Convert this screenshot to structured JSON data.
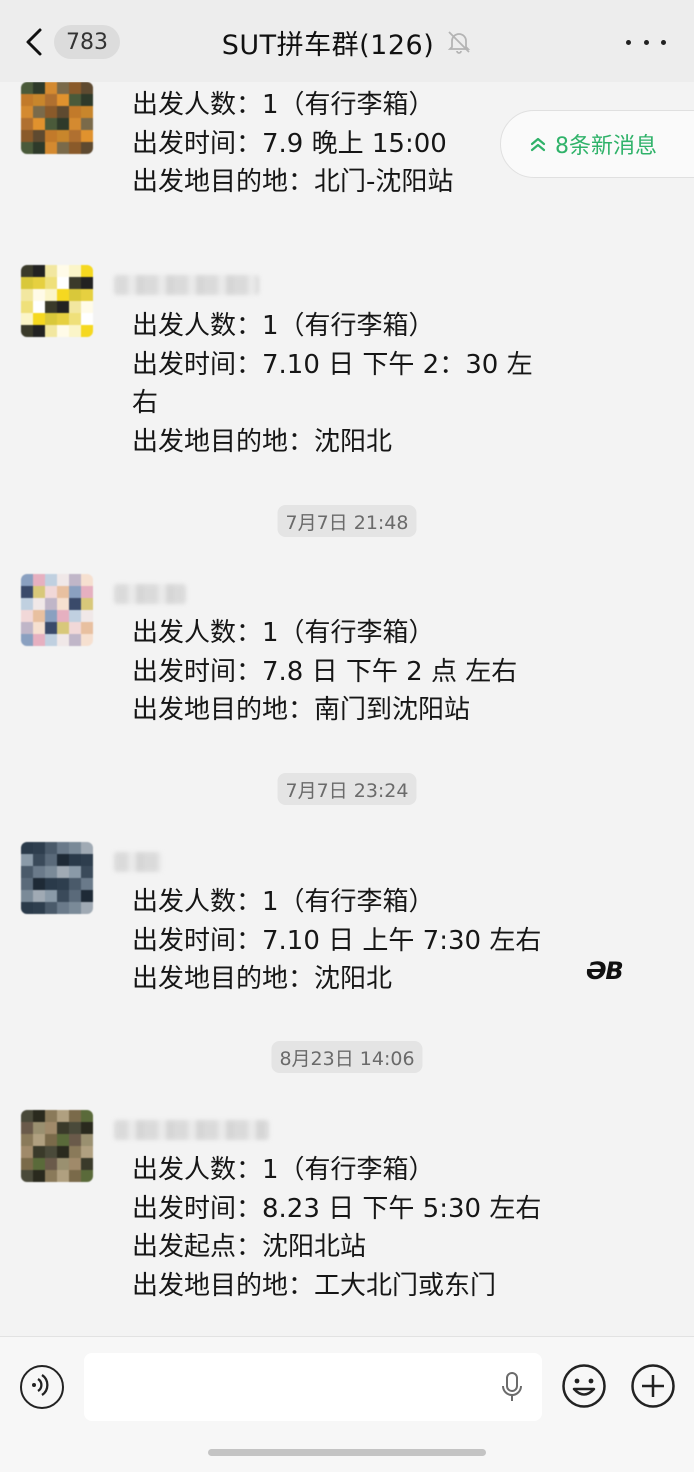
{
  "header": {
    "unread_count": "783",
    "title": "SUT拼车群(126)"
  },
  "new_messages_pill": "8条新消息",
  "timestamps": [
    "7月7日 21:48",
    "7月7日 23:24",
    "8月23日 14:06"
  ],
  "messages": [
    {
      "lines": [
        "出发人数：1（有行李箱）",
        "出发时间：7.9 晚上 15:00",
        "出发地目的地：北门-沈阳站"
      ]
    },
    {
      "lines": [
        "出发人数：1（有行李箱）",
        "出发时间：7.10 日 下午 2：30 左",
        "右",
        "出发地目的地：沈阳北"
      ]
    },
    {
      "lines": [
        "出发人数：1（有行李箱）",
        "出发时间：7.8 日 下午 2 点 左右",
        "出发地目的地：南门到沈阳站"
      ]
    },
    {
      "lines": [
        "出发人数：1（有行李箱）",
        "出发时间：7.10 日 上午 7:30 左右",
        "出发地目的地：沈阳北"
      ]
    },
    {
      "lines": [
        "出发人数：1（有行李箱）",
        "出发时间：8.23 日 下午 5:30 左右",
        "出发起点：沈阳北站",
        "出发地目的地：工大北门或东门"
      ]
    }
  ],
  "sticker_text": "ƏB",
  "colors": {
    "accent_green": "#2fb269",
    "header_bg": "#ededed",
    "chat_bg": "#f3f3f3"
  },
  "icons": [
    "back-chevron-icon",
    "mute-bell-icon",
    "more-dots-icon",
    "double-chevron-up-icon",
    "voice-icon",
    "microphone-icon",
    "emoji-icon",
    "plus-icon"
  ]
}
